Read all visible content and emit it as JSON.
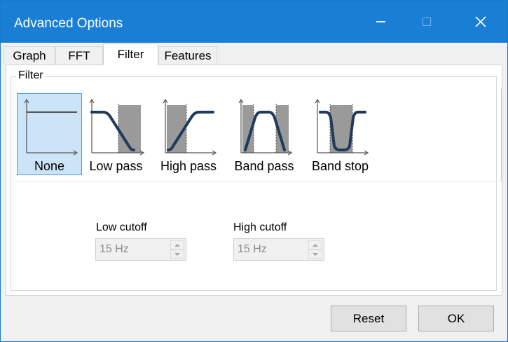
{
  "window": {
    "title": "Advanced Options",
    "controls": {
      "minimize_icon": "minimize-icon",
      "maximize_icon": "maximize-icon",
      "close_icon": "close-icon"
    },
    "titlebar_color": "#1a7fd4"
  },
  "tabs": [
    {
      "label": "Graph",
      "active": false
    },
    {
      "label": "FFT",
      "active": false
    },
    {
      "label": "Filter",
      "active": true
    },
    {
      "label": "Features",
      "active": false
    }
  ],
  "filter_group": {
    "label": "Filter",
    "options": [
      {
        "label": "None",
        "icon": "flat-response-icon",
        "selected": true
      },
      {
        "label": "Low pass",
        "icon": "low-pass-icon",
        "selected": false
      },
      {
        "label": "High pass",
        "icon": "high-pass-icon",
        "selected": false
      },
      {
        "label": "Band pass",
        "icon": "band-pass-icon",
        "selected": false
      },
      {
        "label": "Band stop",
        "icon": "band-stop-icon",
        "selected": false
      }
    ],
    "selection_color": "#cce4f7"
  },
  "cutoffs": {
    "low": {
      "label": "Low cutoff",
      "value": "15 Hz",
      "enabled": false
    },
    "high": {
      "label": "High cutoff",
      "value": "15 Hz",
      "enabled": false
    }
  },
  "buttons": {
    "reset": "Reset",
    "ok": "OK"
  }
}
